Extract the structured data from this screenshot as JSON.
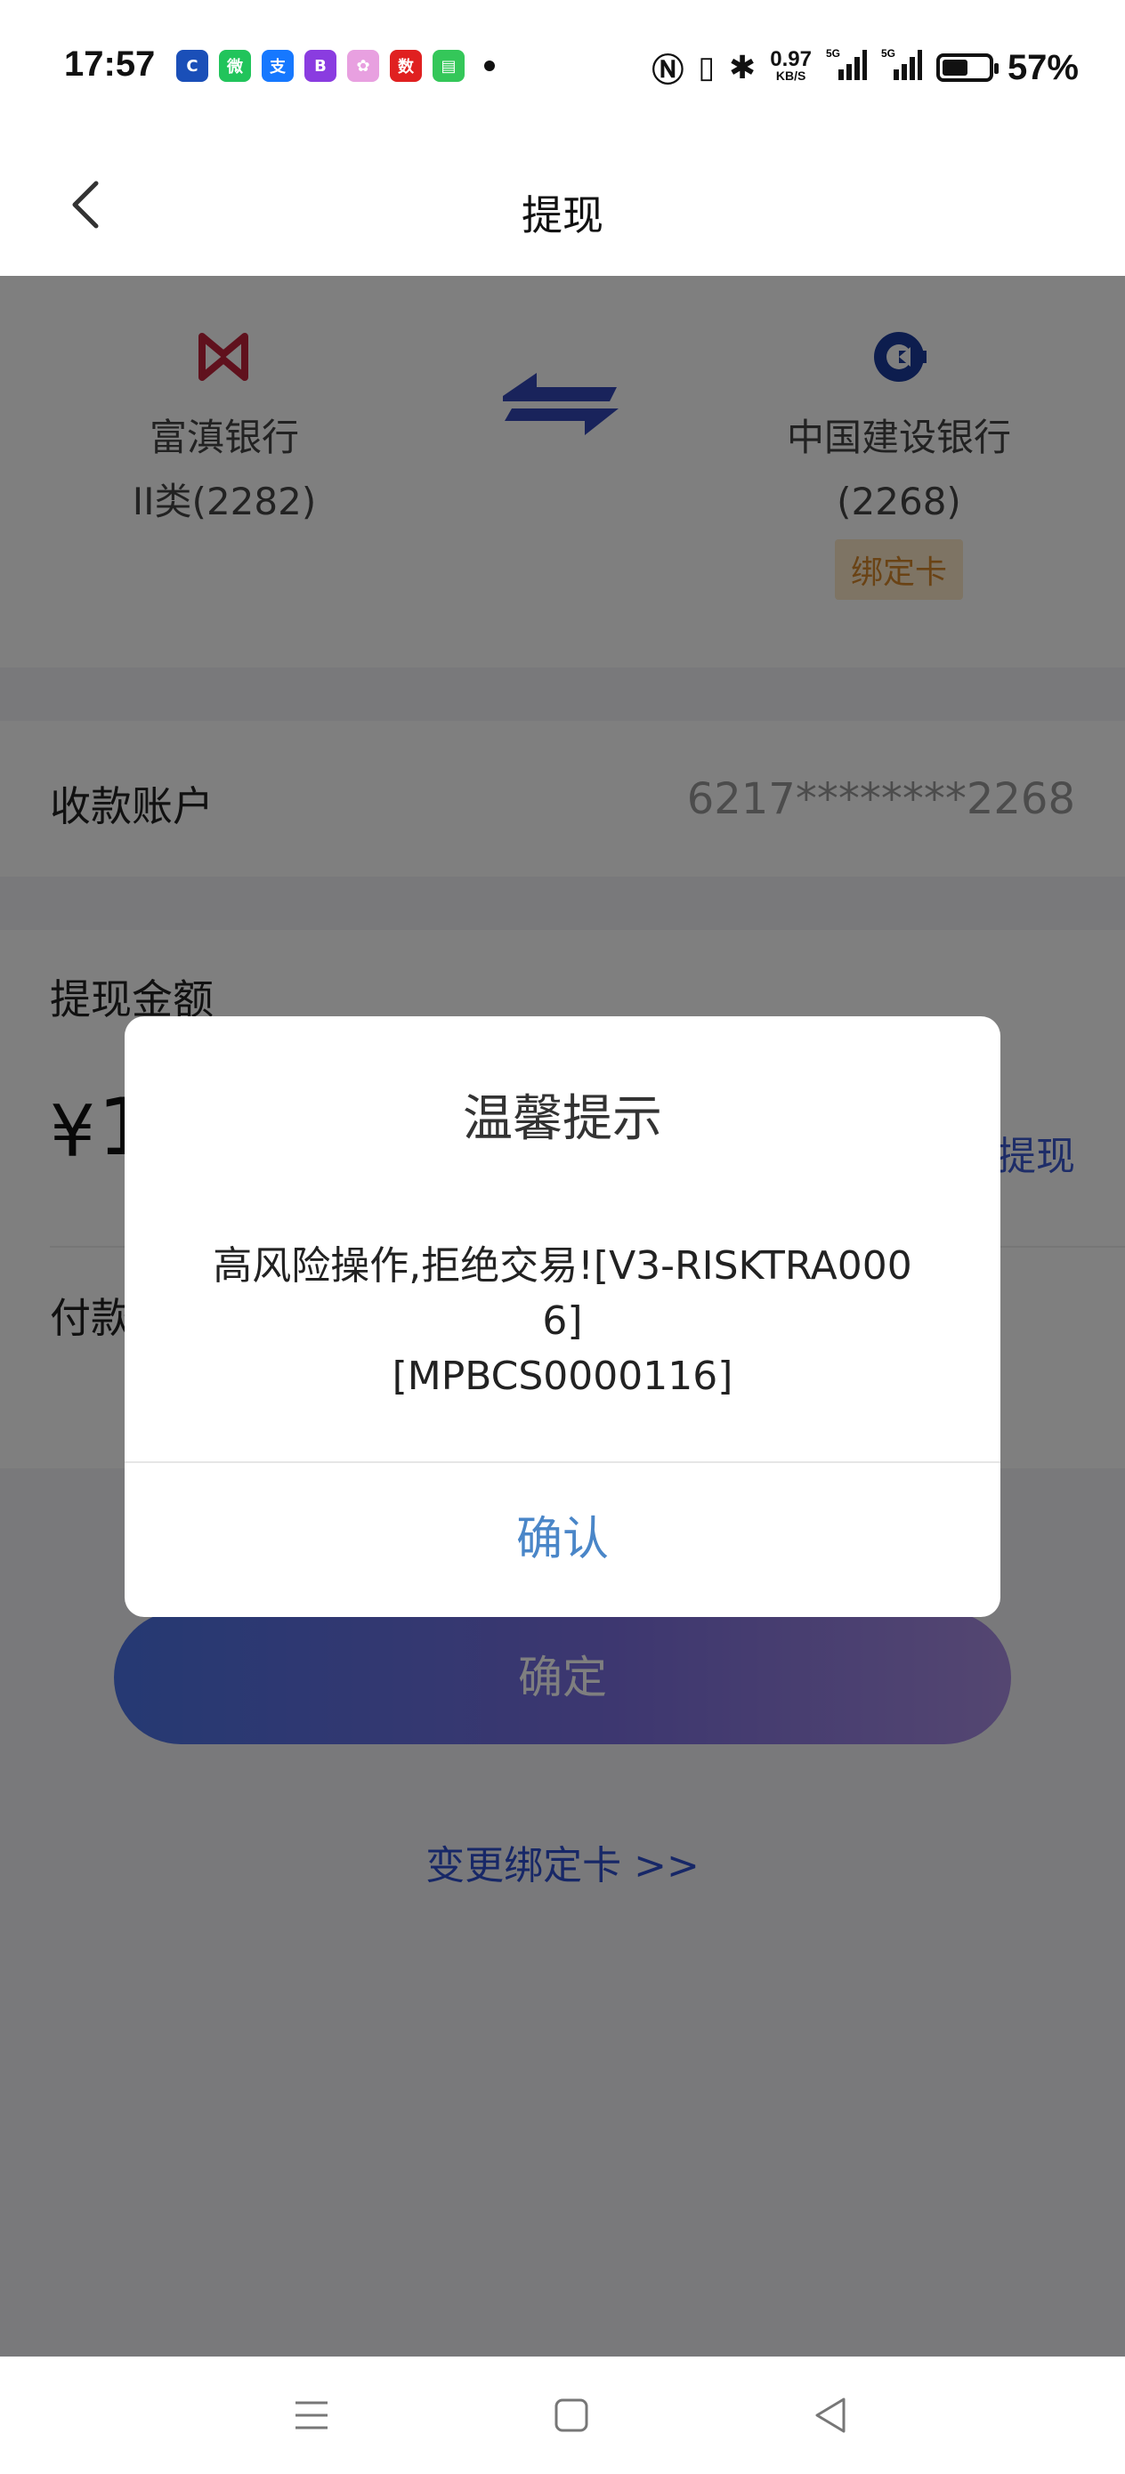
{
  "status_bar": {
    "time": "17:57",
    "app_icons": [
      {
        "name": "ccb-icon",
        "color": "#1a4fb8",
        "glyph": "C"
      },
      {
        "name": "wechat-icon",
        "color": "#21c45b",
        "glyph": "微"
      },
      {
        "name": "alipay-icon",
        "color": "#1678ff",
        "glyph": "支"
      },
      {
        "name": "bank-app-icon",
        "color": "#8a3ce0",
        "glyph": "B"
      },
      {
        "name": "colorful-app-icon",
        "color": "#e8a0e0",
        "glyph": "✿"
      },
      {
        "name": "digital-id-icon",
        "color": "#e02020",
        "glyph": "数"
      },
      {
        "name": "message-icon",
        "color": "#34c759",
        "glyph": "▤"
      }
    ],
    "net_speed": "0.97",
    "net_unit": "KB/S",
    "battery_level": 0.57,
    "battery_pct": "57%"
  },
  "header": {
    "title": "提现"
  },
  "transfer": {
    "from_bank_name": "富滇银行",
    "from_account": "II类(2282)",
    "to_bank_name": "中国建设银行",
    "to_account": "(2268)",
    "to_tag": "绑定卡",
    "from_color": "#c0223a",
    "to_color": "#1a3a9c"
  },
  "account_row": {
    "label": "收款账户",
    "value": "6217********2268"
  },
  "amount": {
    "label": "提现金额",
    "currency": "¥",
    "value": "1",
    "all_label": "提现",
    "pay_label": "付款"
  },
  "confirm_button": "确定",
  "change_card_link": "变更绑定卡 >>",
  "dialog": {
    "title": "温馨提示",
    "message": "高风险操作,拒绝交易![V3-RISKTRA000\n6]\n[MPBCS0000116]",
    "ok": "确认"
  }
}
